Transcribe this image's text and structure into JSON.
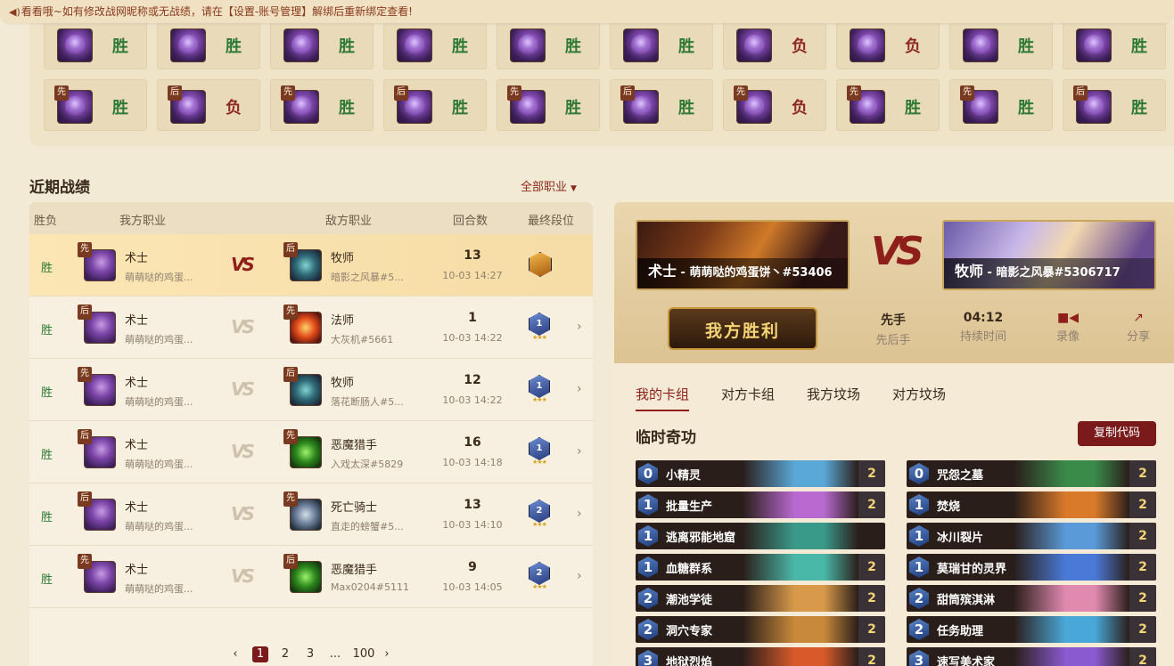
{
  "notice": {
    "text": "看看哦~如有修改战网昵称或无战绩，请在【设置-账号管理】解绑后重新绑定查看!"
  },
  "grid": {
    "row1": [
      {
        "tag": "",
        "result": "胜",
        "win": true
      },
      {
        "tag": "",
        "result": "胜",
        "win": true
      },
      {
        "tag": "",
        "result": "胜",
        "win": true
      },
      {
        "tag": "",
        "result": "胜",
        "win": true
      },
      {
        "tag": "",
        "result": "胜",
        "win": true
      },
      {
        "tag": "",
        "result": "胜",
        "win": true
      },
      {
        "tag": "",
        "result": "负",
        "win": false
      },
      {
        "tag": "",
        "result": "负",
        "win": false
      },
      {
        "tag": "",
        "result": "胜",
        "win": true
      },
      {
        "tag": "",
        "result": "胜",
        "win": true
      }
    ],
    "row2": [
      {
        "tag": "先",
        "result": "胜",
        "win": true
      },
      {
        "tag": "后",
        "result": "负",
        "win": false
      },
      {
        "tag": "先",
        "result": "胜",
        "win": true
      },
      {
        "tag": "后",
        "result": "胜",
        "win": true
      },
      {
        "tag": "先",
        "result": "胜",
        "win": true
      },
      {
        "tag": "后",
        "result": "胜",
        "win": true
      },
      {
        "tag": "先",
        "result": "负",
        "win": false
      },
      {
        "tag": "先",
        "result": "胜",
        "win": true
      },
      {
        "tag": "先",
        "result": "胜",
        "win": true
      },
      {
        "tag": "后",
        "result": "胜",
        "win": true
      }
    ]
  },
  "recent": {
    "title": "近期战绩",
    "filter": "全部职业"
  },
  "table": {
    "headers": {
      "result": "胜负",
      "my_class": "我方职业",
      "opp_class": "敌方职业",
      "rounds": "回合数",
      "rank": "最终段位"
    },
    "rows": [
      {
        "result": "胜",
        "my_tag": "先",
        "my_class": "术士",
        "my_player": "萌萌哒的鸡蛋...",
        "opp_tag": "后",
        "opp_class": "牧师",
        "opp_player": "暗影之风暴#5...",
        "rounds": "13",
        "date": "10-03 14:27",
        "rank": "",
        "opp_icon": "pr"
      },
      {
        "result": "胜",
        "my_tag": "后",
        "my_class": "术士",
        "my_player": "萌萌哒的鸡蛋...",
        "opp_tag": "先",
        "opp_class": "法师",
        "opp_player": "大灰机#5661",
        "rounds": "1",
        "date": "10-03 14:22",
        "rank": "1",
        "opp_icon": "mg"
      },
      {
        "result": "胜",
        "my_tag": "先",
        "my_class": "术士",
        "my_player": "萌萌哒的鸡蛋...",
        "opp_tag": "后",
        "opp_class": "牧师",
        "opp_player": "落花断肠人#5...",
        "rounds": "12",
        "date": "10-03 14:22",
        "rank": "1",
        "opp_icon": "pr"
      },
      {
        "result": "胜",
        "my_tag": "后",
        "my_class": "术士",
        "my_player": "萌萌哒的鸡蛋...",
        "opp_tag": "先",
        "opp_class": "恶魔猎手",
        "opp_player": "入戏太深#5829",
        "rounds": "16",
        "date": "10-03 14:18",
        "rank": "1",
        "opp_icon": "dh"
      },
      {
        "result": "胜",
        "my_tag": "后",
        "my_class": "术士",
        "my_player": "萌萌哒的鸡蛋...",
        "opp_tag": "先",
        "opp_class": "死亡骑士",
        "opp_player": "直走的螃蟹#5...",
        "rounds": "13",
        "date": "10-03 14:10",
        "rank": "2",
        "opp_icon": "dk"
      },
      {
        "result": "胜",
        "my_tag": "先",
        "my_class": "术士",
        "my_player": "萌萌哒的鸡蛋...",
        "opp_tag": "后",
        "opp_class": "恶魔猎手",
        "opp_player": "Max0204#5111",
        "rounds": "9",
        "date": "10-03 14:05",
        "rank": "2",
        "opp_icon": "dh"
      }
    ]
  },
  "pager": {
    "prev": "‹",
    "p1": "1",
    "p2": "2",
    "p3": "3",
    "ellipsis": "...",
    "last": "100",
    "next": "›"
  },
  "detail": {
    "vs": "VS",
    "me": {
      "class": "术士",
      "name": " - 萌萌哒的鸡蛋饼丶#53406"
    },
    "opp": {
      "class": "牧师",
      "name": " - 暗影之风暴#5306717"
    },
    "banner": "我方胜利",
    "turn": {
      "value": "先手",
      "label": "先后手"
    },
    "duration": {
      "value": "04:12",
      "label": "持续时间"
    },
    "record": {
      "label": "录像"
    },
    "share": {
      "label": "分享"
    },
    "tabs": [
      "我的卡组",
      "对方卡组",
      "我方坟场",
      "对方坟场"
    ],
    "deck_name": "临时奇功",
    "copy_label": "复制代码"
  },
  "cards_left": [
    {
      "cost": "0",
      "name": "小精灵",
      "count": "2",
      "color": "#5aa8d8"
    },
    {
      "cost": "1",
      "name": "批量生产",
      "count": "2",
      "color": "#b86ad0"
    },
    {
      "cost": "1",
      "name": "逃离邪能地窟",
      "count": "",
      "color": "#3a9a8a"
    },
    {
      "cost": "1",
      "name": "血糖群系",
      "count": "2",
      "color": "#4ab8a8"
    },
    {
      "cost": "2",
      "name": "潮池学徒",
      "count": "2",
      "color": "#d89a4a"
    },
    {
      "cost": "2",
      "name": "洞穴专家",
      "count": "2",
      "color": "#c88a3a"
    },
    {
      "cost": "3",
      "name": "地狱烈焰",
      "count": "2",
      "color": "#d85a2a"
    }
  ],
  "cards_right": [
    {
      "cost": "0",
      "name": "咒怨之墓",
      "count": "2",
      "color": "#3a8a4a"
    },
    {
      "cost": "1",
      "name": "焚烧",
      "count": "2",
      "color": "#d87a2a"
    },
    {
      "cost": "1",
      "name": "冰川裂片",
      "count": "2",
      "color": "#5a9ad8"
    },
    {
      "cost": "1",
      "name": "莫瑞甘的灵界",
      "count": "2",
      "color": "#4a7ad8"
    },
    {
      "cost": "2",
      "name": "甜筒殡淇淋",
      "count": "2",
      "color": "#e08ab0"
    },
    {
      "cost": "2",
      "name": "任务助理",
      "count": "2",
      "color": "#4aa8d8"
    },
    {
      "cost": "3",
      "name": "速写美术家",
      "count": "2",
      "color": "#8a5ad0"
    }
  ],
  "colors": {
    "accent": "#8e1f1a",
    "win": "#2f7a34",
    "loss": "#8e2a22"
  }
}
